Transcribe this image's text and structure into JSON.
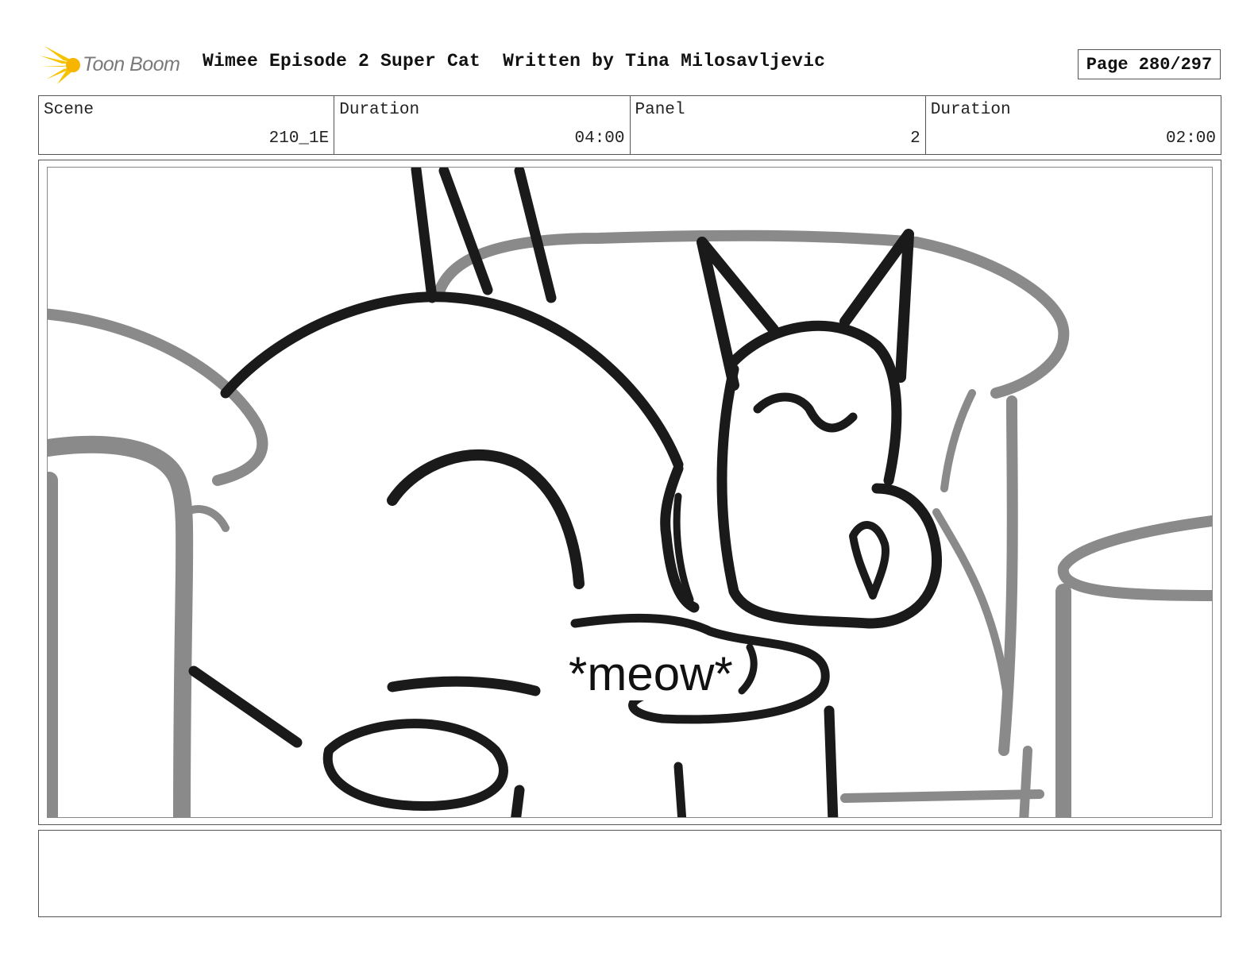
{
  "header": {
    "logo_text": "Toon Boom",
    "title": "Wimee Episode 2 Super Cat",
    "written_by": "Written by Tina Milosavljevic",
    "page": "Page 280/297"
  },
  "info": {
    "scene_label": "Scene",
    "scene_value": "210_1E",
    "scene_duration_label": "Duration",
    "scene_duration_value": "04:00",
    "panel_label": "Panel",
    "panel_value": "2",
    "panel_duration_label": "Duration",
    "panel_duration_value": "02:00"
  },
  "panel": {
    "caption": "*meow*"
  },
  "colors": {
    "logo_yellow": "#f5c400",
    "sketch_black": "#1a1a1a",
    "sketch_gray": "#8a8a8a"
  }
}
